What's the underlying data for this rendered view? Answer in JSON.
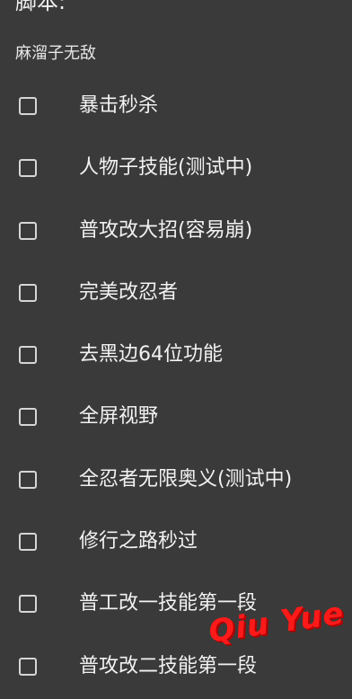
{
  "header": {
    "title": "脚本:",
    "subtitle": "麻溜子无敌"
  },
  "items": [
    {
      "label": "暴击秒杀",
      "checked": false
    },
    {
      "label": "人物子技能(测试中)",
      "checked": false
    },
    {
      "label": "普攻改大招(容易崩)",
      "checked": false
    },
    {
      "label": "完美改忍者",
      "checked": false
    },
    {
      "label": "去黑边64位功能",
      "checked": false
    },
    {
      "label": "全屏视野",
      "checked": false
    },
    {
      "label": "全忍者无限奥义(测试中)",
      "checked": false
    },
    {
      "label": "修行之路秒过",
      "checked": false
    },
    {
      "label": "普工改一技能第一段",
      "checked": false
    },
    {
      "label": "普攻改二技能第一段",
      "checked": false
    }
  ],
  "watermark": "Qiu Yue",
  "colors": {
    "background": "#3a3a3a",
    "text": "#f2f2f2",
    "checkbox_border": "#d6d6d6",
    "watermark": "#ff1a1a"
  }
}
